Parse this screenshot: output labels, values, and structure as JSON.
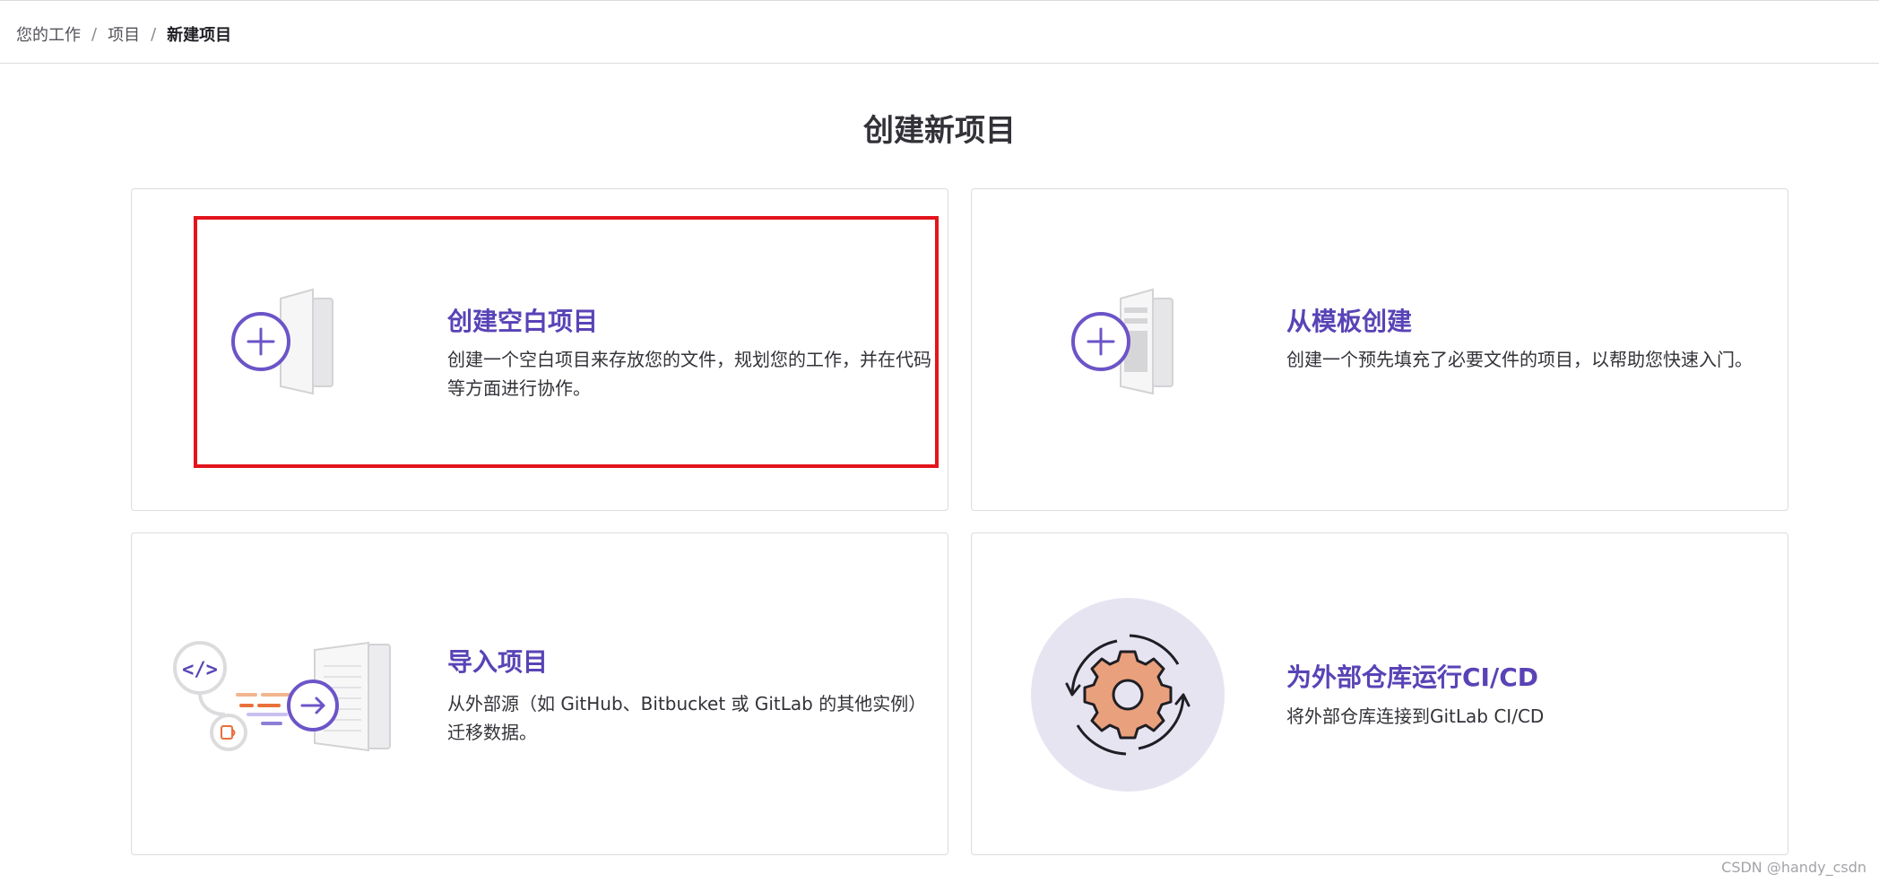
{
  "breadcrumb": {
    "items": [
      "您的工作",
      "项目"
    ],
    "current": "新建项目",
    "separator": "/"
  },
  "page": {
    "title": "创建新项目"
  },
  "cards": [
    {
      "title": "创建空白项目",
      "description": "创建一个空白项目来存放您的文件，规划您的工作，并在代码等方面进行协作。",
      "icon": "blank-project-illustration"
    },
    {
      "title": "从模板创建",
      "description": "创建一个预先填充了必要文件的项目，以帮助您快速入门。",
      "icon": "template-project-illustration"
    },
    {
      "title": "导入项目",
      "description": "从外部源（如 GitHub、Bitbucket 或 GitLab 的其他实例）迁移数据。",
      "icon": "import-project-illustration"
    },
    {
      "title": "为外部仓库运行CI/CD",
      "description": "将外部仓库连接到GitLab CI/CD",
      "icon": "ci-cd-gear-illustration"
    }
  ],
  "watermark": "CSDN @handy_csdn",
  "colors": {
    "accent": "#5943b6",
    "highlight": "#e3141c",
    "border": "#dcdcde",
    "gear": "#e9a07c"
  }
}
